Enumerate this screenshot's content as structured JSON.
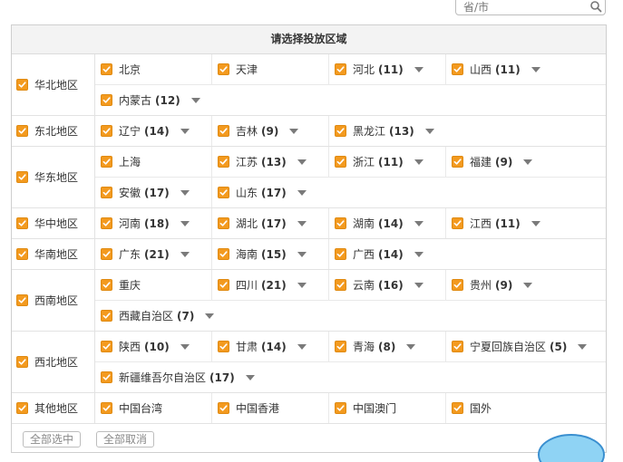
{
  "search": {
    "placeholder": "省/市"
  },
  "table": {
    "title": "请选择投放区域"
  },
  "regions": [
    {
      "name": "华北地区",
      "lines": [
        [
          {
            "label": "北京",
            "count": "",
            "dropdown": false
          },
          {
            "label": "天津",
            "count": "",
            "dropdown": false
          },
          {
            "label": "河北",
            "count": "(11)",
            "dropdown": true
          },
          {
            "label": "山西",
            "count": "(11)",
            "dropdown": true
          }
        ],
        [
          {
            "label": "内蒙古",
            "count": "(12)",
            "dropdown": true
          }
        ]
      ]
    },
    {
      "name": "东北地区",
      "lines": [
        [
          {
            "label": "辽宁",
            "count": "(14)",
            "dropdown": true
          },
          {
            "label": "吉林",
            "count": "(9)",
            "dropdown": true
          },
          {
            "label": "黑龙江",
            "count": "(13)",
            "dropdown": true
          }
        ]
      ]
    },
    {
      "name": "华东地区",
      "lines": [
        [
          {
            "label": "上海",
            "count": "",
            "dropdown": false
          },
          {
            "label": "江苏",
            "count": "(13)",
            "dropdown": true
          },
          {
            "label": "浙江",
            "count": "(11)",
            "dropdown": true
          },
          {
            "label": "福建",
            "count": "(9)",
            "dropdown": true
          }
        ],
        [
          {
            "label": "安徽",
            "count": "(17)",
            "dropdown": true
          },
          {
            "label": "山东",
            "count": "(17)",
            "dropdown": true
          }
        ]
      ]
    },
    {
      "name": "华中地区",
      "lines": [
        [
          {
            "label": "河南",
            "count": "(18)",
            "dropdown": true
          },
          {
            "label": "湖北",
            "count": "(17)",
            "dropdown": true
          },
          {
            "label": "湖南",
            "count": "(14)",
            "dropdown": true
          },
          {
            "label": "江西",
            "count": "(11)",
            "dropdown": true
          }
        ]
      ]
    },
    {
      "name": "华南地区",
      "lines": [
        [
          {
            "label": "广东",
            "count": "(21)",
            "dropdown": true
          },
          {
            "label": "海南",
            "count": "(15)",
            "dropdown": true
          },
          {
            "label": "广西",
            "count": "(14)",
            "dropdown": true
          }
        ]
      ]
    },
    {
      "name": "西南地区",
      "lines": [
        [
          {
            "label": "重庆",
            "count": "",
            "dropdown": false
          },
          {
            "label": "四川",
            "count": "(21)",
            "dropdown": true
          },
          {
            "label": "云南",
            "count": "(16)",
            "dropdown": true
          },
          {
            "label": "贵州",
            "count": "(9)",
            "dropdown": true
          }
        ],
        [
          {
            "label": "西藏自治区",
            "count": "(7)",
            "dropdown": true
          }
        ]
      ]
    },
    {
      "name": "西北地区",
      "lines": [
        [
          {
            "label": "陕西",
            "count": "(10)",
            "dropdown": true
          },
          {
            "label": "甘肃",
            "count": "(14)",
            "dropdown": true
          },
          {
            "label": "青海",
            "count": "(8)",
            "dropdown": true
          },
          {
            "label": "宁夏回族自治区",
            "count": "(5)",
            "dropdown": true
          }
        ],
        [
          {
            "label": "新疆维吾尔自治区",
            "count": "(17)",
            "dropdown": true
          }
        ]
      ]
    },
    {
      "name": "其他地区",
      "lines": [
        [
          {
            "label": "中国台湾",
            "count": "",
            "dropdown": false
          },
          {
            "label": "中国香港",
            "count": "",
            "dropdown": false
          },
          {
            "label": "中国澳门",
            "count": "",
            "dropdown": false
          },
          {
            "label": "国外",
            "count": "",
            "dropdown": false
          }
        ]
      ]
    }
  ],
  "footer": {
    "select_all": "全部选中",
    "deselect_all": "全部取消"
  },
  "colors": {
    "checkbox": "#f39a1f",
    "arrow": "#7a7a7a",
    "border": "#cfcfcf"
  },
  "icons": {
    "search": "search-icon",
    "checkbox": "checkbox-checked-icon",
    "dropdown": "caret-down-icon"
  }
}
